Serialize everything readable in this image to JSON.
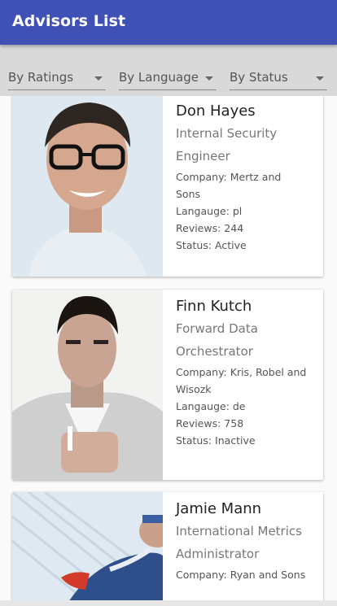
{
  "appbar": {
    "title": "Advisors List"
  },
  "filters": [
    {
      "label": "By Ratings"
    },
    {
      "label": "By Language"
    },
    {
      "label": "By Status"
    }
  ],
  "advisors": [
    {
      "name": "Don Hayes",
      "title_line1": "Internal Security",
      "title_line2": "Engineer",
      "company_line1": "Company: Mertz and",
      "company_line2": "Sons",
      "language": "Langauge: pl",
      "reviews": "Reviews: 244",
      "status": "Status: Active"
    },
    {
      "name": "Finn Kutch",
      "title_line1": "Forward Data",
      "title_line2": "Orchestrator",
      "company_line1": "Company: Kris, Robel and",
      "company_line2": "Wisozk",
      "language": "Langauge: de",
      "reviews": "Reviews: 758",
      "status": "Status: Inactive"
    },
    {
      "name": "Jamie Mann",
      "title_line1": "International Metrics",
      "title_line2": "Administrator",
      "company_line1": "Company: Ryan and Sons",
      "company_line2": "",
      "language": "",
      "reviews": "",
      "status": ""
    }
  ]
}
